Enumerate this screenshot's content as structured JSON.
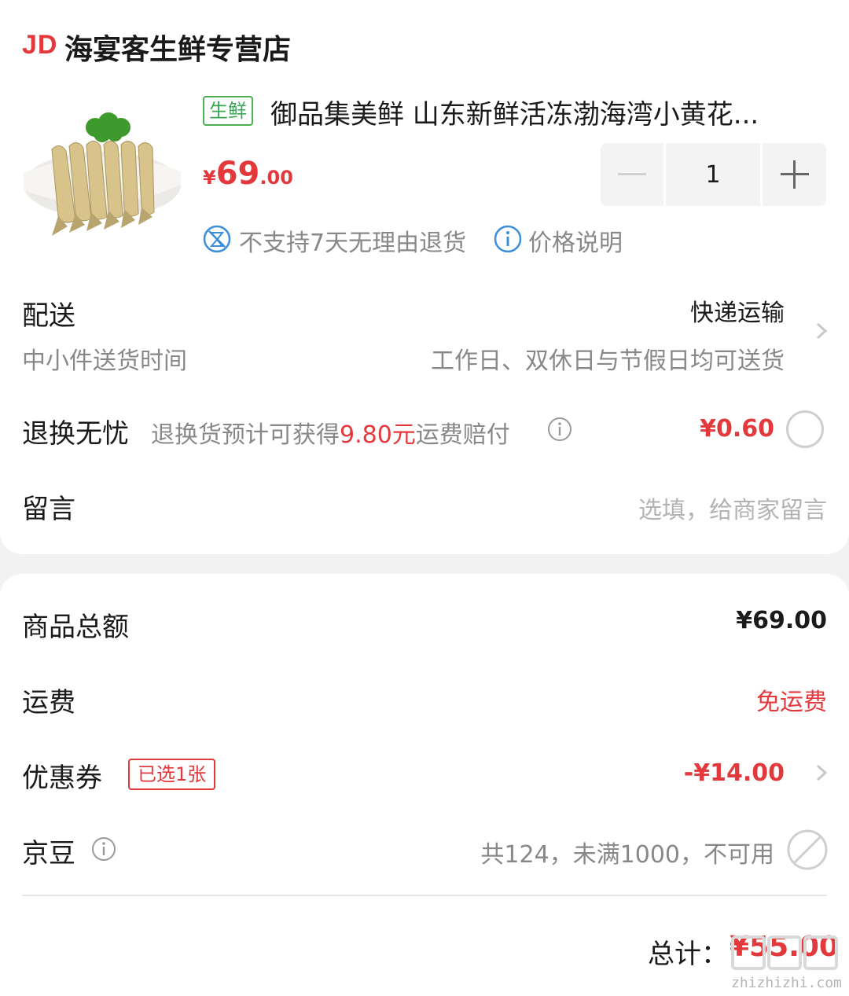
{
  "store": {
    "logo": "JD",
    "name": "海宴客生鲜专营店"
  },
  "product": {
    "tag": "生鲜",
    "title": "御品集美鲜 山东新鲜活冻渤海湾小黄花...",
    "price_symbol": "¥",
    "price_int": "69",
    "price_dec": ".00",
    "quantity": "1",
    "notice_no_return": "不支持7天无理由退货",
    "notice_price": "价格说明",
    "image_icon": "yellow-croaker-fish-icon"
  },
  "delivery": {
    "label": "配送",
    "method": "快递运输",
    "time_label": "中小件送货时间",
    "time_value": "工作日、双休日与节假日均可送货"
  },
  "return_service": {
    "label": "退换无忧",
    "desc_prefix": "退换货预计可获得",
    "desc_amount": "9.80元",
    "desc_suffix": "运费赔付",
    "price": "¥0.60"
  },
  "message": {
    "label": "留言",
    "placeholder": "选填，给商家留言"
  },
  "summary": {
    "goods_total_label": "商品总额",
    "goods_total_value": "¥69.00",
    "shipping_label": "运费",
    "shipping_value": "免运费",
    "coupon_label": "优惠券",
    "coupon_tag": "已选1张",
    "coupon_value": "-¥14.00",
    "jingdou_label": "京豆",
    "jingdou_value": "共124，未满1000，不可用",
    "total_label": "总计：",
    "total_value": "¥55.00"
  },
  "watermark": "zhizhizhi.com",
  "colors": {
    "accent_red": "#e4393c",
    "fresh_green": "#4caf50",
    "info_blue": "#3b8fd8"
  }
}
